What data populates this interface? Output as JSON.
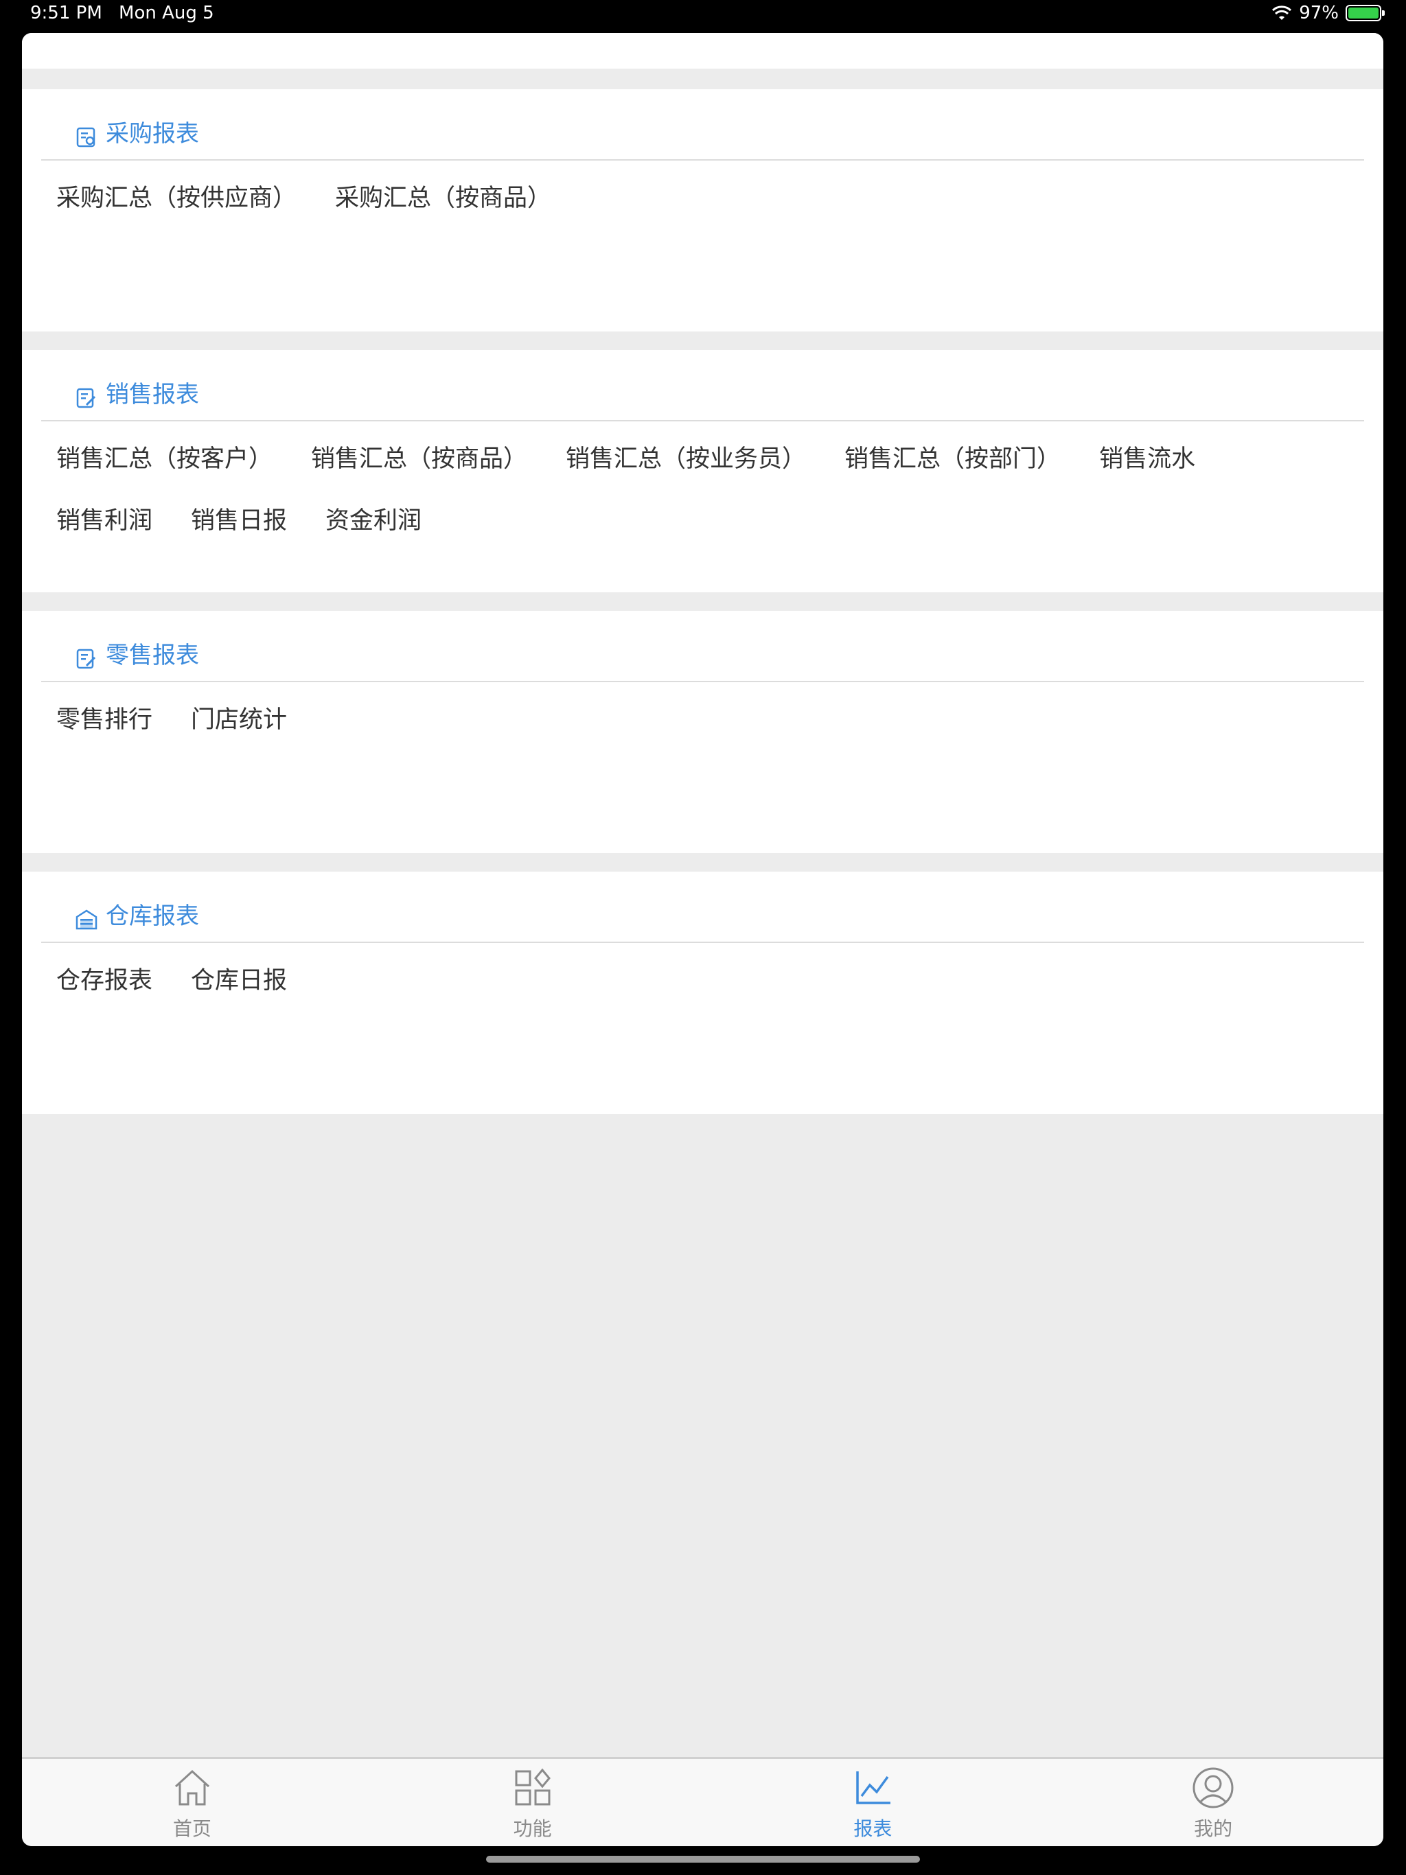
{
  "status": {
    "time": "9:51 PM",
    "date": "Mon Aug 5",
    "battery": "97%"
  },
  "colors": {
    "accent": "#3d8bdc",
    "text": "#333333",
    "muted": "#8a8a8a",
    "background": "#ececec"
  },
  "sections": [
    {
      "title": "采购报表",
      "icon": "report-icon",
      "items": [
        "采购汇总（按供应商）",
        "采购汇总（按商品）"
      ]
    },
    {
      "title": "销售报表",
      "icon": "report-edit-icon",
      "items": [
        "销售汇总（按客户）",
        "销售汇总（按商品）",
        "销售汇总（按业务员）",
        "销售汇总（按部门）",
        "销售流水",
        "销售利润",
        "销售日报",
        "资金利润"
      ]
    },
    {
      "title": "零售报表",
      "icon": "report-edit-icon",
      "items": [
        "零售排行",
        "门店统计"
      ]
    },
    {
      "title": "仓库报表",
      "icon": "warehouse-icon",
      "items": [
        "仓存报表",
        "仓库日报"
      ]
    }
  ],
  "tabs": [
    {
      "label": "首页",
      "icon": "home-icon",
      "active": false
    },
    {
      "label": "功能",
      "icon": "grid-icon",
      "active": false
    },
    {
      "label": "报表",
      "icon": "chart-icon",
      "active": true
    },
    {
      "label": "我的",
      "icon": "user-icon",
      "active": false
    }
  ]
}
